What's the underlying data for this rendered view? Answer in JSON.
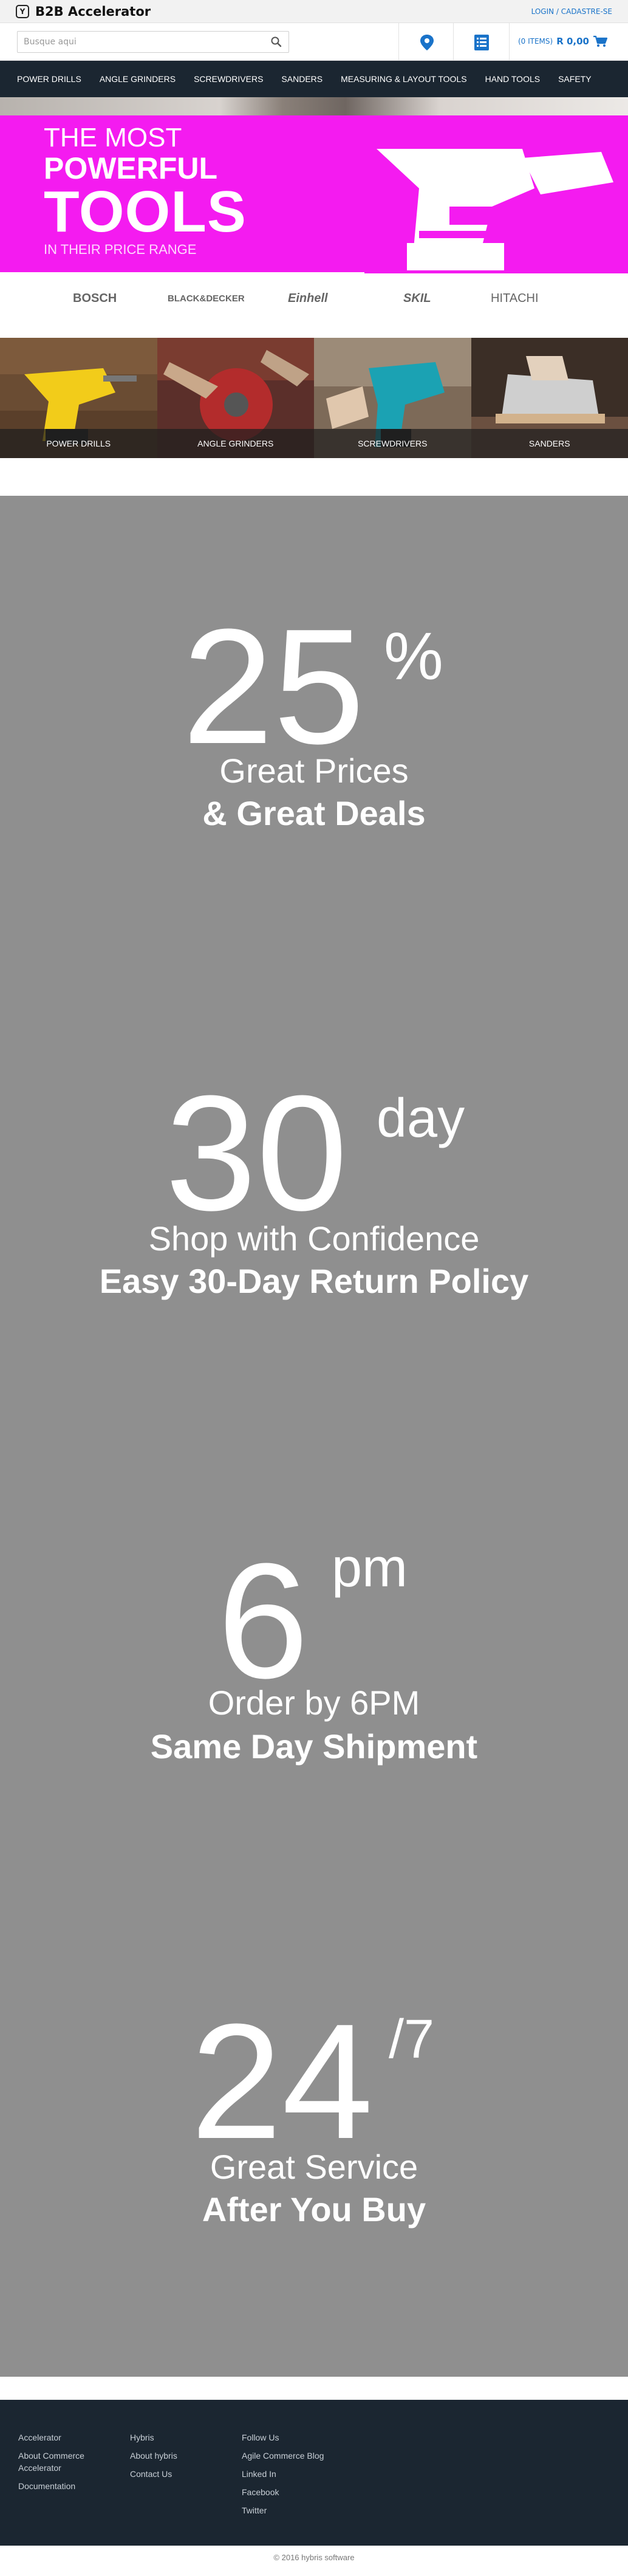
{
  "header": {
    "brand": "B2B Accelerator",
    "brand_logo_glyph": "Y",
    "login_link": "LOGIN / CADASTRE-SE"
  },
  "search": {
    "placeholder": "Busque aqui",
    "value": ""
  },
  "cart": {
    "items": "(0 ITEMS)",
    "total": "R 0,00"
  },
  "nav": {
    "items": [
      "POWER DRILLS",
      "ANGLE GRINDERS",
      "SCREWDRIVERS",
      "SANDERS",
      "MEASURING & LAYOUT TOOLS",
      "HAND TOOLS",
      "SAFETY"
    ]
  },
  "hero": {
    "line1": "THE MOST",
    "line2": "POWERFUL",
    "line3": "TOOLS",
    "line4": "IN THEIR PRICE RANGE",
    "brands": [
      "BOSCH",
      "BLACK&DECKER",
      "Einhell",
      "SKIL",
      "HITACHI"
    ],
    "accent_color": "#f41bf0"
  },
  "categories": [
    "POWER DRILLS",
    "ANGLE GRINDERS",
    "SCREWDRIVERS",
    "SANDERS"
  ],
  "promos": [
    {
      "big": "25",
      "sup": "%",
      "line1": "Great Prices",
      "line2": "& Great Deals"
    },
    {
      "big": "30",
      "sup": "day",
      "line1": "Shop with Confidence",
      "line2": "Easy 30-Day Return Policy"
    },
    {
      "big": "6",
      "sup": "pm",
      "line1": "Order by 6PM",
      "line2": "Same Day Shipment"
    },
    {
      "big": "24",
      "sup": "/7",
      "line1": "Great Service",
      "line2": "After You Buy"
    }
  ],
  "footer": {
    "col1": [
      "Accelerator",
      "About Commerce Accelerator",
      "Documentation"
    ],
    "col2": [
      "Hybris",
      "About hybris",
      "Contact Us"
    ],
    "col3": [
      "Follow Us",
      "Agile Commerce Blog",
      "Linked In",
      "Facebook",
      "Twitter"
    ],
    "copyright": "© 2016 hybris software"
  }
}
